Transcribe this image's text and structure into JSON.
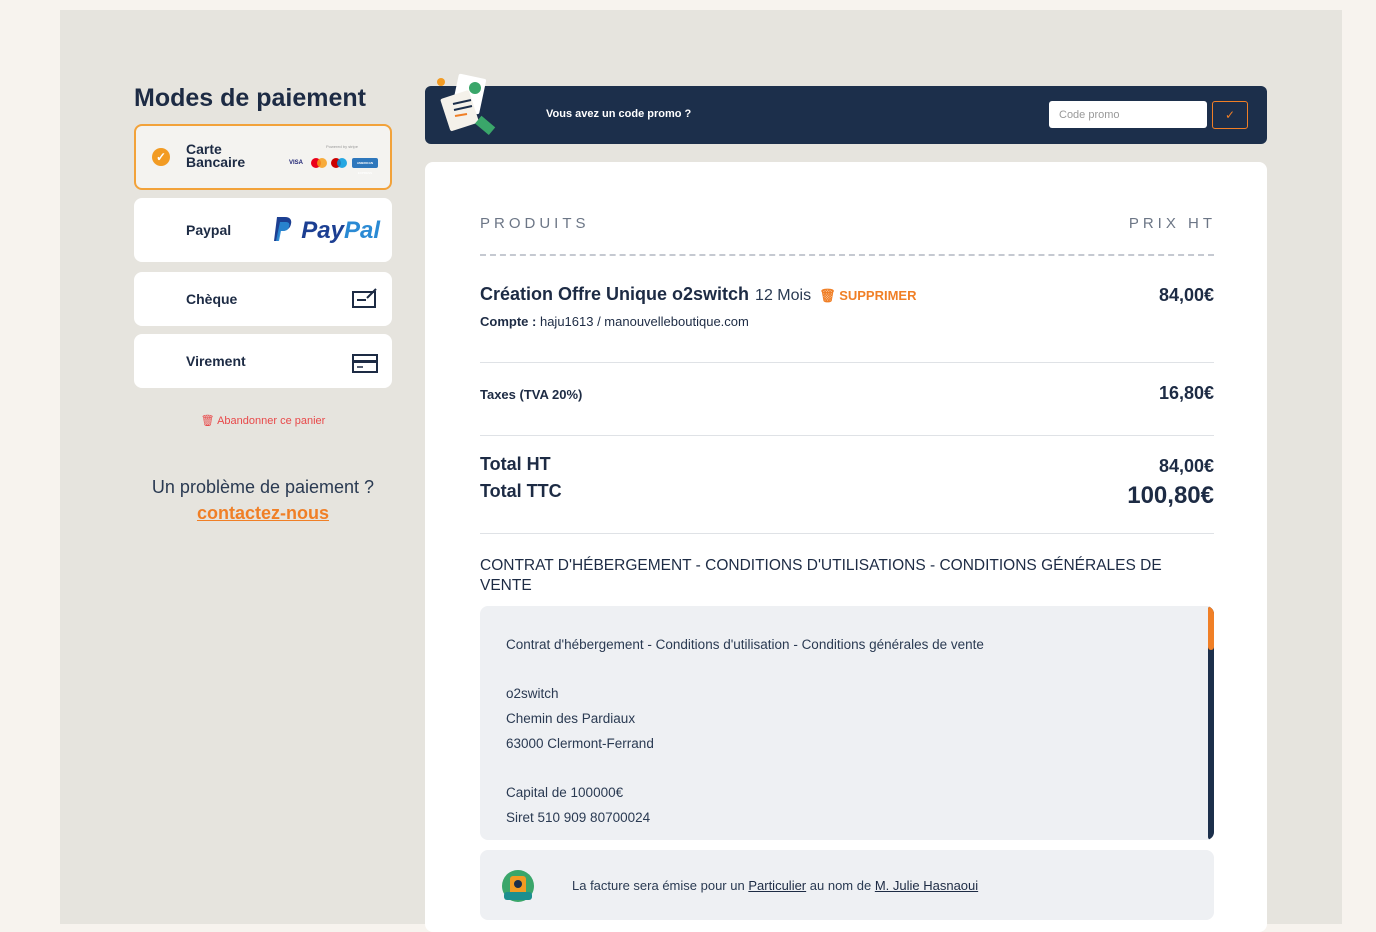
{
  "sidebar": {
    "title": "Modes de paiement",
    "methods": [
      {
        "label": "Carte\nBancaire",
        "selected": true,
        "icon": "card-brands-logos"
      },
      {
        "label": "Paypal",
        "selected": false,
        "icon": "paypal-logo"
      },
      {
        "label": "Chèque",
        "selected": false,
        "icon": "cheque-icon"
      },
      {
        "label": "Virement",
        "selected": false,
        "icon": "bank-transfer-icon"
      }
    ],
    "card_brands": {
      "stripe_tag": "Powered by stripe",
      "visa": "VISA",
      "amex": "AMERICAN EXPRESS"
    },
    "paypal_logo": {
      "pay": "Pay",
      "pal": "Pal"
    },
    "abandon_label": "Abandonner ce panier",
    "help_text": "Un problème de paiement ?",
    "help_link": "contactez-nous"
  },
  "promo": {
    "text": "Vous avez un code promo ?",
    "placeholder": "Code promo",
    "submit_icon": "check-icon"
  },
  "cart": {
    "col_products": "PRODUITS",
    "col_price": "PRIX HT",
    "product": {
      "name": "Création Offre Unique o2switch",
      "duration": "12 Mois",
      "delete_label": "SUPPRIMER",
      "account_label": "Compte :",
      "account_value": "haju1613 / manouvelleboutique.com",
      "price": "84,00€"
    },
    "taxes_label": "Taxes (TVA 20%)",
    "taxes_value": "16,80€",
    "total_ht_label": "Total HT",
    "total_ht_value": "84,00€",
    "total_ttc_label": "Total TTC",
    "total_ttc_value": "100,80€"
  },
  "contract": {
    "title": "CONTRAT D'HÉBERGEMENT - CONDITIONS D'UTILISATIONS - CONDITIONS GÉNÉRALES DE VENTE",
    "lines": [
      "Contrat d'hébergement - Conditions d'utilisation - Conditions générales de vente",
      "",
      "o2switch",
      "Chemin des Pardiaux",
      "63000 Clermont-Ferrand",
      "",
      "Capital de 100000€",
      "Siret 510 909 80700024"
    ]
  },
  "invoice": {
    "prefix": "La facture sera émise pour un",
    "type_link": "Particulier",
    "middle": "au nom de",
    "name_link": "M. Julie Hasnaoui"
  },
  "colors": {
    "accent": "#f07f26",
    "navy": "#1c2f4b",
    "danger": "#e8494a"
  }
}
